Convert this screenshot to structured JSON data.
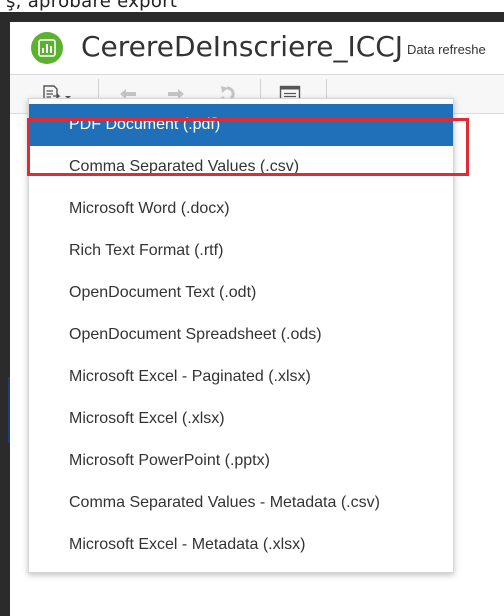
{
  "app": {
    "title": "CerereDeInscriere_ICCJ",
    "data_refresh_label": "Data refreshe",
    "top_crop_text": "ş, aprobare export"
  },
  "toolbar": {
    "buttons": [
      {
        "name": "export",
        "icon": "export-icon"
      },
      {
        "name": "undo",
        "icon": "undo-icon"
      },
      {
        "name": "redo",
        "icon": "redo-icon"
      },
      {
        "name": "revert",
        "icon": "revert-icon"
      },
      {
        "name": "view",
        "icon": "view-icon"
      }
    ]
  },
  "export_menu": {
    "selected_index": 0,
    "items": [
      {
        "label": "PDF Document (.pdf)"
      },
      {
        "label": "Comma Separated Values (.csv)"
      },
      {
        "label": "Microsoft Word (.docx)"
      },
      {
        "label": "Rich Text Format (.rtf)"
      },
      {
        "label": "OpenDocument Text (.odt)"
      },
      {
        "label": "OpenDocument Spreadsheet (.ods)"
      },
      {
        "label": "Microsoft Excel - Paginated (.xlsx)"
      },
      {
        "label": "Microsoft Excel (.xlsx)"
      },
      {
        "label": "Microsoft PowerPoint (.pptx)"
      },
      {
        "label": "Comma Separated Values - Metadata (.csv)"
      },
      {
        "label": "Microsoft Excel - Metadata (.xlsx)"
      }
    ]
  },
  "colors": {
    "accent": "#1f70b8",
    "highlight_border": "#e02b35",
    "app_icon": "#5cb230"
  }
}
